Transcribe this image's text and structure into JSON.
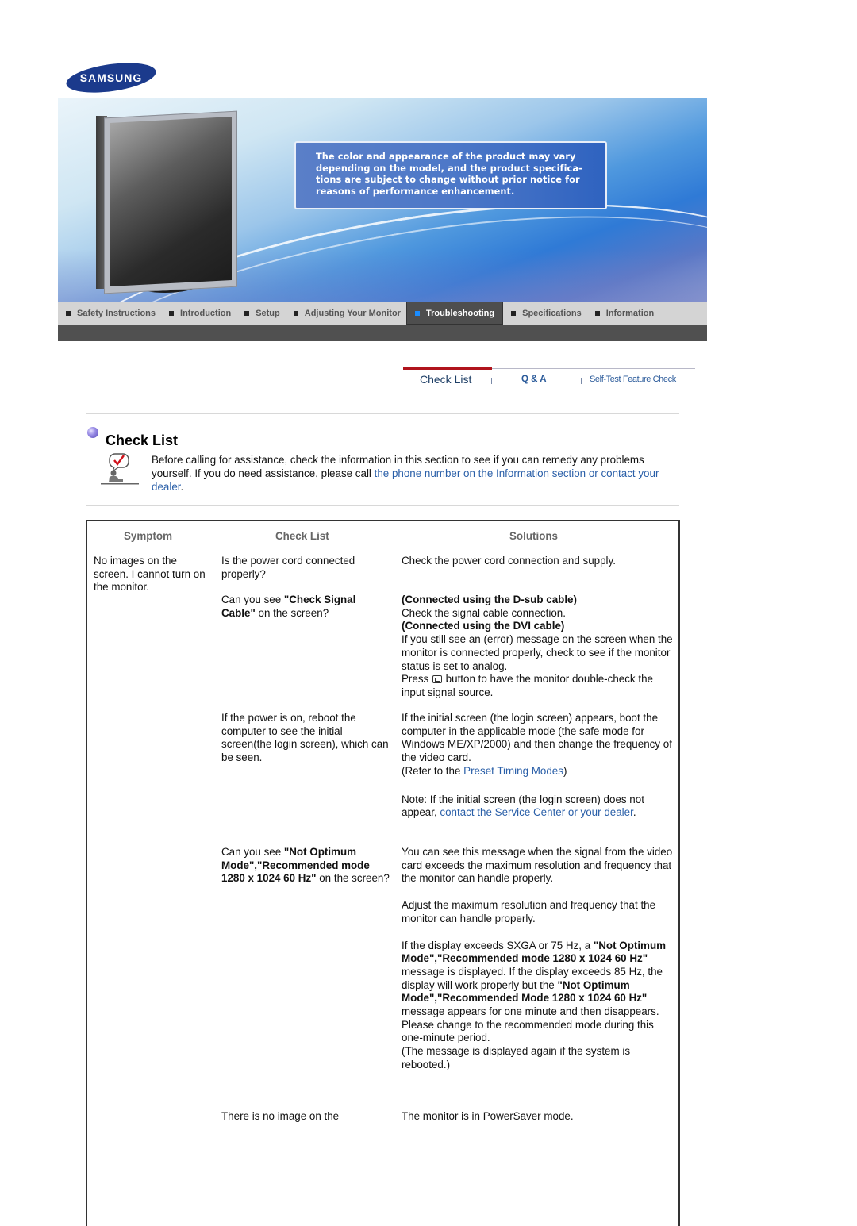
{
  "brand": {
    "logo_text": "SAMSUNG",
    "logo_color": "#1b3a8c"
  },
  "banner": {
    "notice": "The color and appearance of the product may vary depending on the model, and the product specifica-tions are subject to change without prior notice for reasons of performance enhancement.",
    "notice_lines": [
      "The color and appearance of the product may vary",
      "depending on the model, and the product specifica-",
      "tions are subject to change without prior notice for",
      "reasons of performance enhancement."
    ]
  },
  "nav": {
    "items": [
      {
        "label": "Safety Instructions",
        "active": false
      },
      {
        "label": "Introduction",
        "active": false
      },
      {
        "label": "Setup",
        "active": false
      },
      {
        "label": "Adjusting Your Monitor",
        "active": false
      },
      {
        "label": "Troubleshooting",
        "active": true
      },
      {
        "label": "Specifications",
        "active": false
      },
      {
        "label": "Information",
        "active": false
      }
    ],
    "active_color": "#1a8cff"
  },
  "subtabs": {
    "items": [
      {
        "label": "Check List",
        "active": true
      },
      {
        "label": "Q & A",
        "active": false
      },
      {
        "label": "Self-Test Feature Check",
        "active": false
      }
    ],
    "active_bar_color": "#b0141c"
  },
  "section": {
    "title": "Check List",
    "intro_text_1": "Before calling for assistance, check the information in this section to see if you can remedy any problems yourself. If you do need assistance, please call ",
    "intro_link": "the phone number on the Information section or contact your dealer",
    "intro_text_2": "."
  },
  "table": {
    "headers": {
      "symptom": "Symptom",
      "check_list": "Check List",
      "solutions": "Solutions"
    },
    "rows": [
      {
        "symptom": "No images on the screen. I cannot turn on the monitor.",
        "check": "Is the power cord connected properly?",
        "solution": "Check the power cord connection and supply."
      },
      {
        "check_pre": "Can you see ",
        "check_bold": "\"Check Signal Cable\"",
        "check_post": " on the screen?",
        "sol_h1": "(Connected using the D-sub cable)",
        "sol_t1": "Check the signal cable connection.",
        "sol_h2": "(Connected using the DVI cable)",
        "sol_t2": "If you still see an (error) message on the screen when the monitor is connected properly, check to see if the monitor status is set to analog.",
        "sol_t3_pre": "Press ",
        "sol_t3_icon": "source-button-icon",
        "sol_t3_post": " button to have the monitor double-check the input signal source."
      },
      {
        "check": "If the power is on, reboot the computer to see the initial screen(the login screen), which can be seen.",
        "sol_p1": "If the initial screen (the login screen) appears, boot the computer in the applicable mode (the safe mode for Windows ME/XP/2000) and then change the frequency of the video card.",
        "sol_p2_pre": "(Refer to the ",
        "sol_p2_link": "Preset Timing Modes",
        "sol_p2_post": ")",
        "sol_p3_pre": "Note: If the initial screen (the login screen) does not appear, ",
        "sol_p3_link": "contact the Service Center or your dealer",
        "sol_p3_post": "."
      },
      {
        "check_pre": "Can you see ",
        "check_bold": "\"Not Optimum Mode\",\"Recommended mode 1280 x 1024 60 Hz\"",
        "check_post": " on the screen?",
        "sol_p1": "You can see this message when the signal from the video card exceeds the maximum resolution and frequency that the monitor can handle properly.",
        "sol_p2": "Adjust the maximum resolution and frequency that the monitor can handle properly.",
        "sol_p3_a": "If the display exceeds SXGA or 75 Hz, a ",
        "sol_p3_b": "\"Not Optimum Mode\",\"Recommended mode 1280 x 1024 60 Hz\"",
        "sol_p3_c": " message is displayed. If the display exceeds 85 Hz, the display will work properly but the ",
        "sol_p3_d": "\"Not Optimum Mode\",\"Recommended Mode 1280 x 1024 60 Hz\"",
        "sol_p3_e": " message appears for one minute and then disappears.",
        "sol_p3_f": "Please change to the recommended mode during this one-minute period.",
        "sol_p3_g": "(The message is displayed again if the system is rebooted.)"
      },
      {
        "check": "There is no image on the",
        "solution": "The monitor is in PowerSaver mode."
      }
    ]
  }
}
